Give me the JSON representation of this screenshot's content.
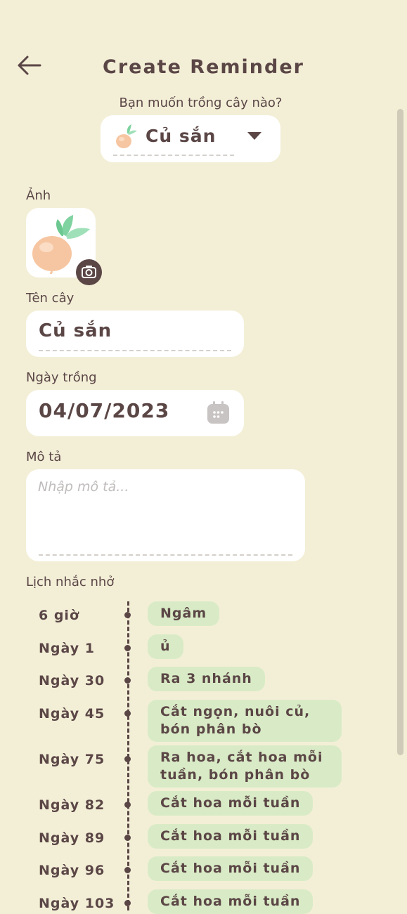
{
  "header": {
    "title": "Create Reminder",
    "back_icon": "arrow-left-icon"
  },
  "plant_picker": {
    "question": "Bạn muốn trồng cây nào?",
    "selected": "Củ sắn",
    "icon": "turnip-icon"
  },
  "photo": {
    "label": "Ảnh",
    "camera_icon": "camera-icon"
  },
  "name": {
    "label": "Tên cây",
    "value": "Củ sắn"
  },
  "date": {
    "label": "Ngày trồng",
    "value": "04/07/2023",
    "icon": "calendar-icon"
  },
  "description": {
    "label": "Mô tả",
    "placeholder": "Nhập mô tả..."
  },
  "schedule": {
    "label": "Lịch nhắc nhở",
    "items": [
      {
        "time": "6 giờ",
        "task": "Ngâm"
      },
      {
        "time": "Ngày 1",
        "task": "ủ"
      },
      {
        "time": "Ngày 30",
        "task": "Ra 3 nhánh"
      },
      {
        "time": "Ngày 45",
        "task": "Cắt ngọn, nuôi củ, bón phân bò"
      },
      {
        "time": "Ngày 75",
        "task": "Ra hoa, cắt hoa mỗi tuần, bón phân bò"
      },
      {
        "time": "Ngày 82",
        "task": "Cắt hoa mỗi tuần"
      },
      {
        "time": "Ngày 89",
        "task": "Cắt hoa mỗi tuần"
      },
      {
        "time": "Ngày 96",
        "task": "Cắt hoa mỗi tuần"
      },
      {
        "time": "Ngày 103",
        "task": "Cắt hoa mỗi tuần"
      }
    ]
  },
  "colors": {
    "background": "#f3efd7",
    "text": "#5b4646",
    "chip": "#d9ebc6"
  }
}
